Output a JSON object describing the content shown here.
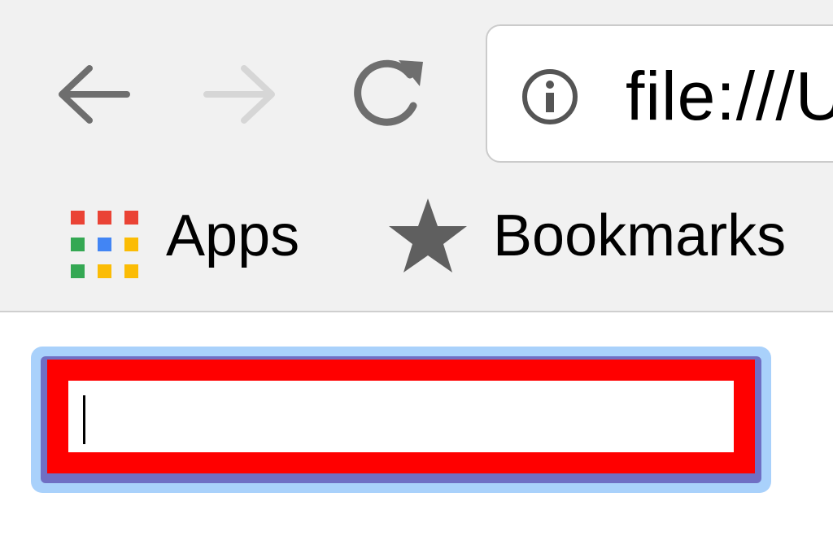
{
  "toolbar": {
    "back_icon": "arrow-left-icon",
    "forward_icon": "arrow-right-icon",
    "reload_icon": "reload-icon"
  },
  "omnibox": {
    "security_icon": "info-icon",
    "url": "file:///U"
  },
  "bookmarks_bar": {
    "items": [
      {
        "label": "Apps",
        "icon": "apps-grid-icon"
      },
      {
        "label": "Bookmarks",
        "icon": "star-icon"
      }
    ]
  },
  "page": {
    "text_input": {
      "value": "",
      "border_color": "#ff0000",
      "focus_color": "#a9d1fb"
    }
  },
  "colors": {
    "chrome_bg": "#f1f1f1",
    "icon_gray": "#6e6e6e",
    "icon_disabled": "#d6d6d6",
    "apps_red": "#ea4335",
    "apps_green": "#34a853",
    "apps_blue": "#4285f4",
    "apps_yellow": "#fbbc05"
  }
}
